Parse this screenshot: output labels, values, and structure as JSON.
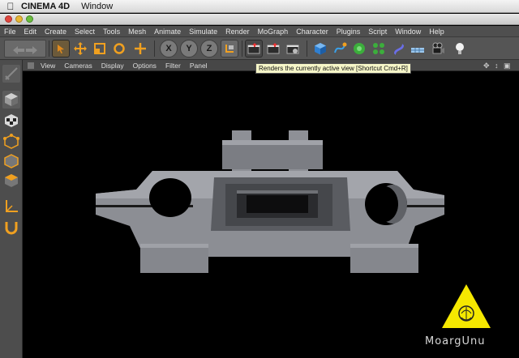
{
  "mac_menu": {
    "app_name": "CINEMA 4D",
    "items": [
      "Window"
    ]
  },
  "app_menu": [
    "File",
    "Edit",
    "Create",
    "Select",
    "Tools",
    "Mesh",
    "Animate",
    "Simulate",
    "Render",
    "MoGraph",
    "Character",
    "Plugins",
    "Script",
    "Window",
    "Help"
  ],
  "toolbar": {
    "axis_x": "X",
    "axis_y": "Y",
    "axis_z": "Z",
    "icons": [
      "undo-redo-icon",
      "move-cursor-icon",
      "scale-icon",
      "rotate-icon",
      "move-axis-icon",
      "world-coordinate-icon",
      "render-view-icon",
      "render-picture-viewer-icon",
      "render-settings-icon",
      "cube-icon",
      "spline-pen-icon",
      "nurbs-icon",
      "array-icon",
      "deformer-icon",
      "floor-icon",
      "camera-icon",
      "light-icon"
    ]
  },
  "viewport_menu": [
    "View",
    "Cameras",
    "Display",
    "Options",
    "Filter",
    "Panel"
  ],
  "tooltip": "Renders the currently active view [Shortcut Cmd+R]",
  "watermark": "MoargUnu",
  "colors": {
    "toolbar_bg": "#555555",
    "viewport_bg": "#000000",
    "model_gray": "#8c8e94",
    "tooltip_bg": "#f6f6c8",
    "logo_yellow": "#f5e800"
  }
}
